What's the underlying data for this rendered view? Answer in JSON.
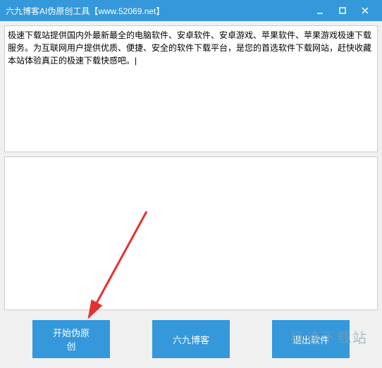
{
  "window": {
    "title": "六九博客AI伪原创工具【www.52069.net】"
  },
  "input": {
    "text": "极速下载站提供国内外最新最全的电脑软件、安卓软件、安卓游戏、苹果软件、苹果游戏极速下载服务。为互联网用户提供优质、便捷、安全的软件下载平台，是您的首选软件下载网站，赶快收藏本站体验真正的极速下载快感吧。|"
  },
  "output": {
    "text": ""
  },
  "buttons": {
    "start": "开始伪原创",
    "blog": "六九博客",
    "exit": "退出软件"
  },
  "watermark": "极速下载站"
}
